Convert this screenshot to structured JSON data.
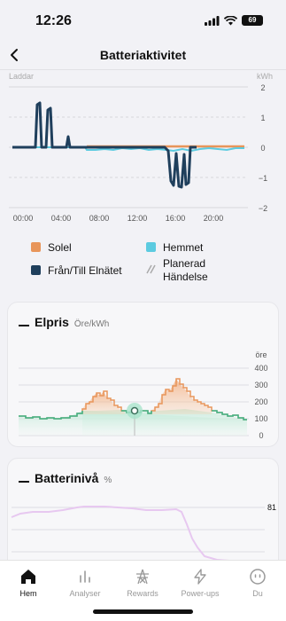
{
  "status": {
    "time": "12:26",
    "battery": "69"
  },
  "nav": {
    "title": "Batteriaktivitet"
  },
  "activity_chart": {
    "left_label": "Laddar",
    "unit": "kWh",
    "y_ticks": [
      "2",
      "1",
      "0",
      "−1",
      "−2"
    ],
    "x_ticks": [
      "00:00",
      "04:00",
      "08:00",
      "12:00",
      "16:00",
      "20:00"
    ]
  },
  "legend": {
    "solar": "Solel",
    "home": "Hemmet",
    "grid": "Från/Till Elnätet",
    "planned_line1": "Planerad",
    "planned_line2": "Händelse"
  },
  "price_card": {
    "title": "Elpris",
    "unit": "Öre/kWh",
    "axis_unit": "öre",
    "y_ticks": [
      "400",
      "300",
      "200",
      "100",
      "0"
    ]
  },
  "battery_card": {
    "title": "Batterinivå",
    "unit": "%",
    "value_label": "81"
  },
  "tabs": [
    {
      "label": "Hem"
    },
    {
      "label": "Analyser"
    },
    {
      "label": "Rewards"
    },
    {
      "label": "Power-ups"
    },
    {
      "label": "Du"
    }
  ],
  "colors": {
    "solar": "#e8955a",
    "home": "#5ccbe0",
    "grid": "#1f3f5c",
    "price_line": "#3bb58a",
    "battery_line": "#e7c8f0"
  }
}
